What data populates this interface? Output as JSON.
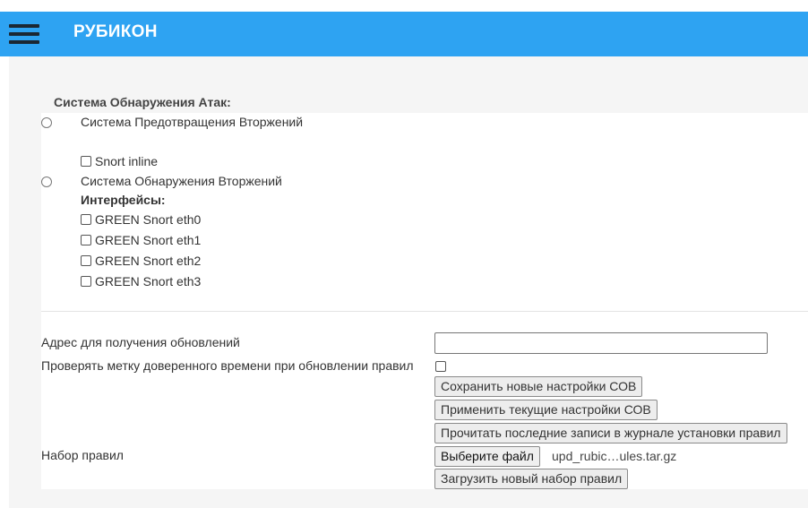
{
  "header": {
    "title": "РУБИКОН"
  },
  "ids": {
    "section_title": "Система Обнаружения Атак:",
    "ips_option": {
      "label": "Система Предотвращения Вторжений",
      "selected": false
    },
    "snort_inline": {
      "label": "Snort inline",
      "checked": false
    },
    "ids_option": {
      "label": "Система Обнаружения Вторжений",
      "selected": false
    },
    "interfaces_heading": "Интерфейсы:",
    "interfaces": [
      {
        "label": "GREEN Snort eth0",
        "checked": false
      },
      {
        "label": "GREEN Snort eth1",
        "checked": false
      },
      {
        "label": "GREEN Snort eth2",
        "checked": false
      },
      {
        "label": "GREEN Snort eth3",
        "checked": false
      }
    ]
  },
  "updates": {
    "address_label": "Адрес для получения обновлений",
    "address_value": "",
    "timestamp_check_label": "Проверять метку доверенного времени при обновлении правил",
    "timestamp_checked": false
  },
  "buttons": {
    "save": "Сохранить новые настройки СОВ",
    "apply": "Применить текущие настройки СОВ",
    "read_log": "Прочитать последние записи в журнале установки правил",
    "choose_file": "Выберите файл",
    "upload": "Загрузить новый набор правил"
  },
  "ruleset": {
    "label": "Набор правил",
    "file_name": "upd_rubic…ules.tar.gz"
  }
}
